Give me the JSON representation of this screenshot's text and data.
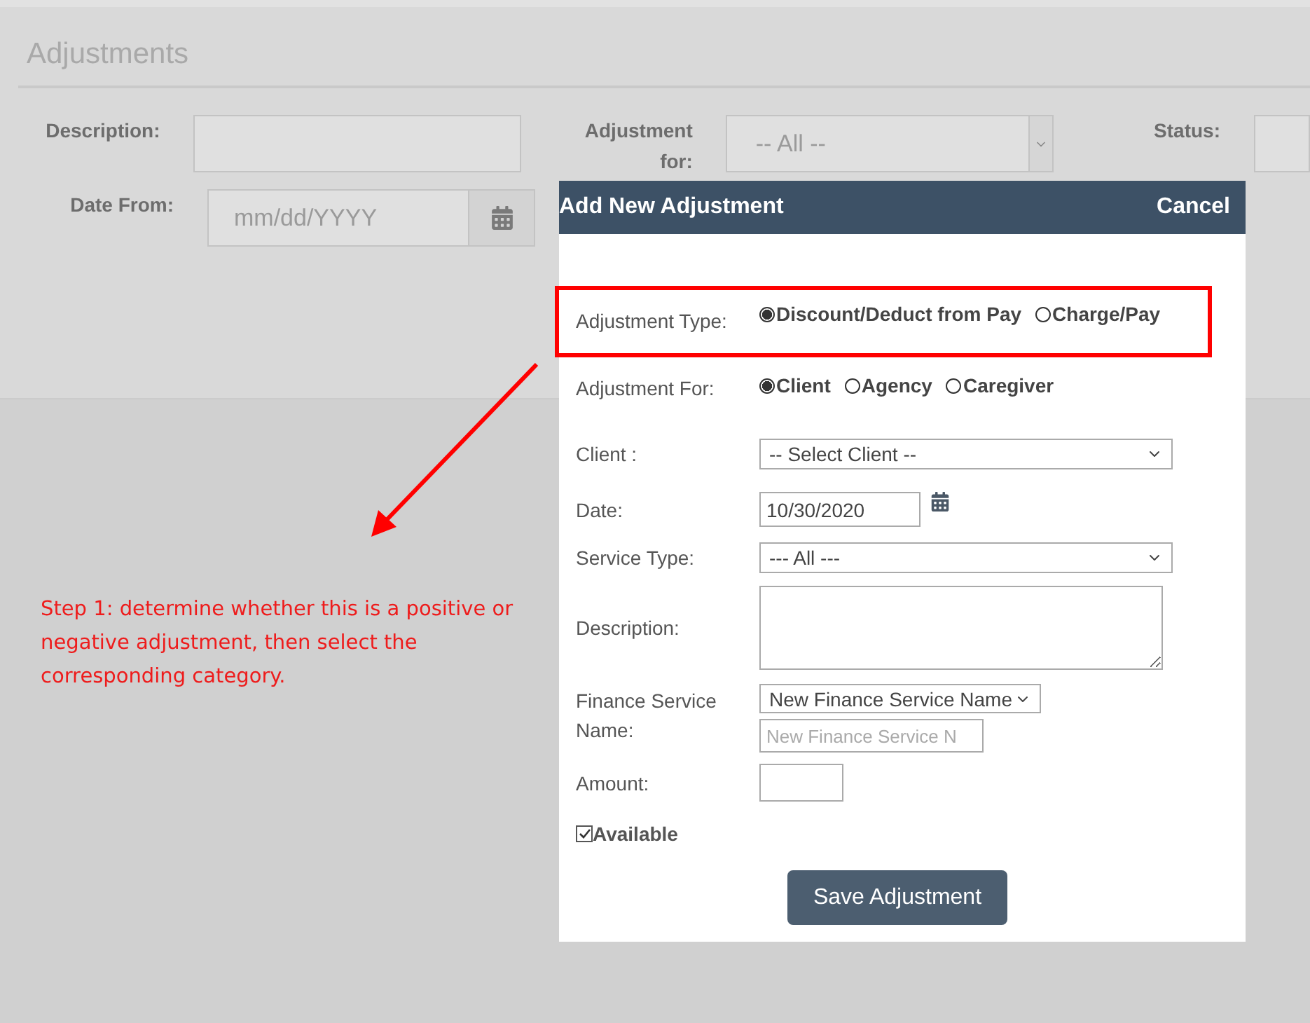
{
  "page": {
    "title": "Adjustments",
    "filters": {
      "description": {
        "label": "Description:"
      },
      "adjustment_for": {
        "label": "Adjustment for:",
        "value": "-- All --"
      },
      "status": {
        "label": "Status:"
      },
      "date_from": {
        "label": "Date From:",
        "placeholder": "mm/dd/YYYY"
      }
    }
  },
  "annotation": {
    "text": "Step 1: determine whether this is a positive or negative adjustment, then select the corresponding category."
  },
  "dialog": {
    "title": "Add New Adjustment",
    "cancel": "Cancel",
    "adjustment_type": {
      "label": "Adjustment Type:",
      "options": [
        {
          "label": "Discount/Deduct from Pay",
          "selected": true
        },
        {
          "label": "Charge/Pay",
          "selected": false
        }
      ]
    },
    "adjustment_for": {
      "label": "Adjustment For:",
      "options": [
        {
          "label": "Client",
          "selected": true
        },
        {
          "label": "Agency",
          "selected": false
        },
        {
          "label": "Caregiver",
          "selected": false
        }
      ]
    },
    "client": {
      "label": "Client :",
      "value": "-- Select Client --"
    },
    "date": {
      "label": "Date:",
      "value": "10/30/2020"
    },
    "service_type": {
      "label": "Service Type:",
      "value": "--- All ---"
    },
    "description": {
      "label": "Description:"
    },
    "finance_service": {
      "label": "Finance Service Name:",
      "value": "New Finance Service Name",
      "placeholder": "New Finance Service N"
    },
    "amount": {
      "label": "Amount:"
    },
    "available": {
      "label": "Available",
      "checked": true
    },
    "save": "Save Adjustment"
  }
}
